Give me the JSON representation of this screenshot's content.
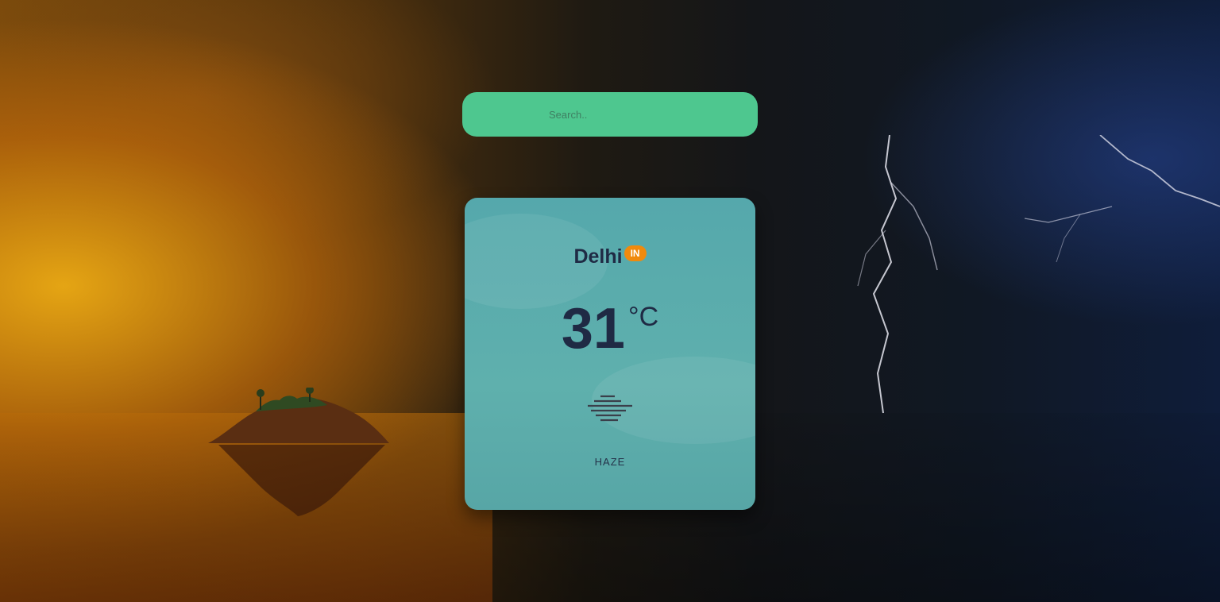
{
  "search": {
    "placeholder": "Search.."
  },
  "weather": {
    "city": "Delhi",
    "country_code": "IN",
    "temperature": "31",
    "unit": "°C",
    "condition": "HAZE",
    "icon": "haze-icon"
  },
  "colors": {
    "search_bar": "#4ec78f",
    "card": "#57a8aa",
    "badge": "#f08a0c",
    "text_dark": "#1f2a44"
  }
}
